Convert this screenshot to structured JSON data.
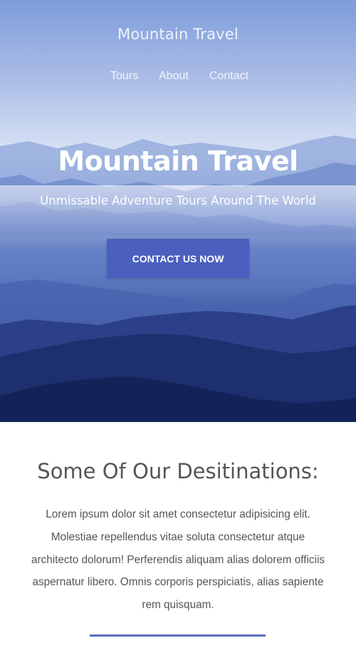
{
  "site": {
    "title": "Mountain Travel"
  },
  "nav": {
    "items": [
      {
        "label": "Tours"
      },
      {
        "label": "About"
      },
      {
        "label": "Contact"
      }
    ]
  },
  "hero": {
    "title": "Mountain Travel",
    "subtitle": "Unmissable Adventure Tours Around The World",
    "cta_label": "CONTACT US NOW"
  },
  "destinations": {
    "title": "Some Of Our Desitinations:",
    "text": "Lorem ipsum dolor sit amet consectetur adipisicing elit. Molestiae repellendus vitae soluta consectetur atque architecto dolorum! Perferendis aliquam alias dolorem officiis aspernatur libero. Omnis corporis perspiciatis, alias sapiente rem quisquam."
  },
  "colors": {
    "accent": "#4b5fbf",
    "divider": "#5a6ec0",
    "text": "#555555"
  }
}
